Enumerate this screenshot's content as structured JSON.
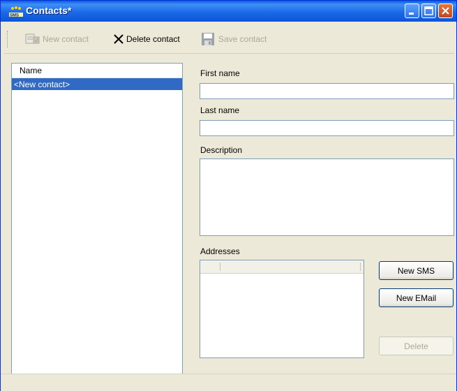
{
  "window": {
    "title": "Contacts*"
  },
  "toolbar": {
    "new_contact": "New contact",
    "delete_contact": "Delete contact",
    "save_contact": "Save contact"
  },
  "contact_list": {
    "header": "Name",
    "items": [
      "<New contact>"
    ]
  },
  "form": {
    "first_name_label": "First name",
    "first_name_value": "",
    "last_name_label": "Last name",
    "last_name_value": "",
    "description_label": "Description",
    "description_value": "",
    "addresses_label": "Addresses"
  },
  "buttons": {
    "new_sms": "New SMS",
    "new_email": "New EMail",
    "delete": "Delete"
  },
  "icons": {
    "app": "sms-app-icon",
    "new_contact": "new-contact-icon",
    "delete_contact": "x-icon",
    "save_contact": "floppy-disk-icon"
  },
  "colors": {
    "titlebar": "#0a5ddc",
    "selection": "#316ac5",
    "disabled_text": "#aca899",
    "window_bg": "#ece9d8"
  }
}
